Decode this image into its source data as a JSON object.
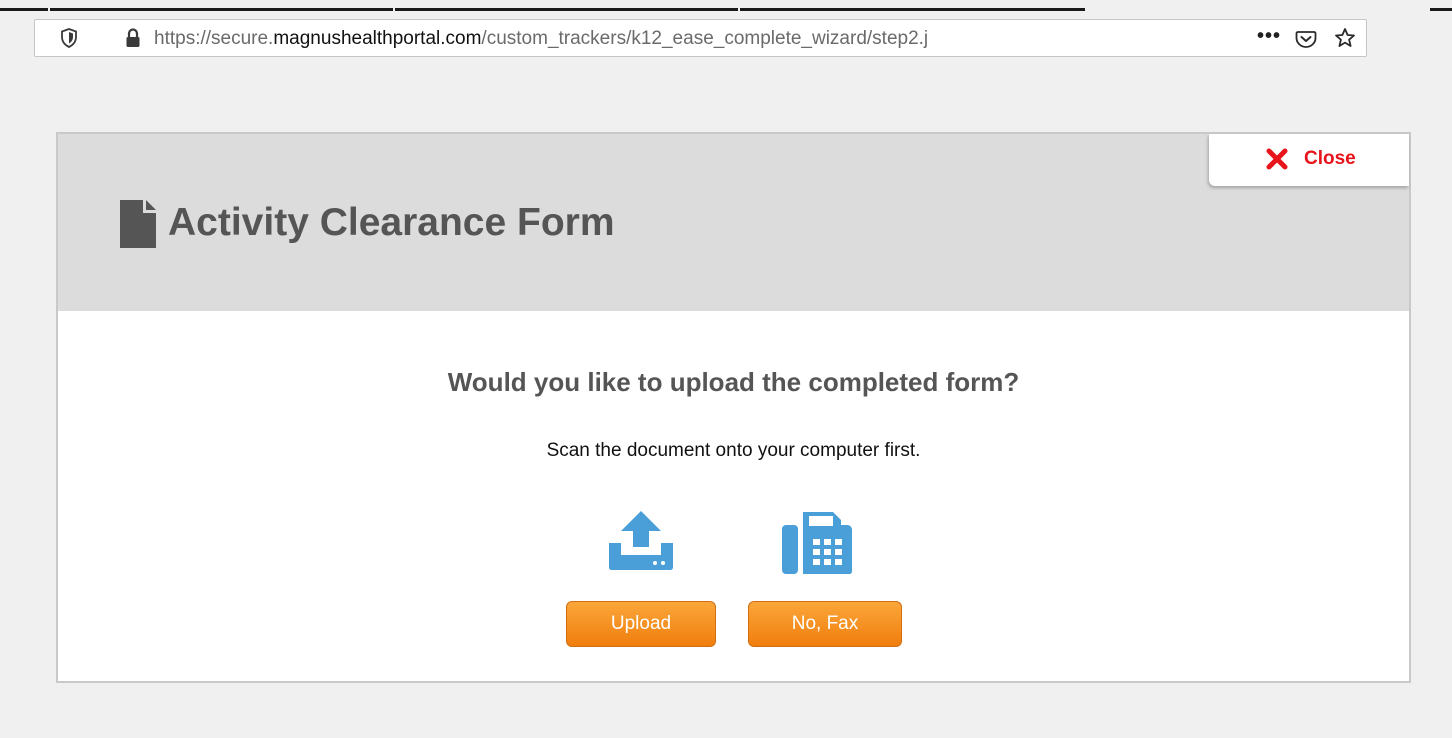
{
  "browser": {
    "url_prefix": "https://secure.",
    "url_domain": "magnushealthportal.com",
    "url_path": "/custom_trackers/k12_ease_complete_wizard/step2.j",
    "menu_dots": "•••"
  },
  "dialog": {
    "close_label": "Close",
    "title": "Activity Clearance Form",
    "question": "Would you like to upload the completed form?",
    "instruction": "Scan the document onto your computer first.",
    "upload_label": "Upload",
    "fax_label": "No, Fax"
  },
  "colors": {
    "accent_orange": "#f5901e",
    "icon_blue": "#4a9fd8",
    "close_red": "#e8141b",
    "header_gray": "#dcdcdc"
  },
  "icons": [
    "shield-icon",
    "lock-icon",
    "pocket-icon",
    "star-icon",
    "close-x-icon",
    "document-icon",
    "upload-icon",
    "fax-icon"
  ]
}
